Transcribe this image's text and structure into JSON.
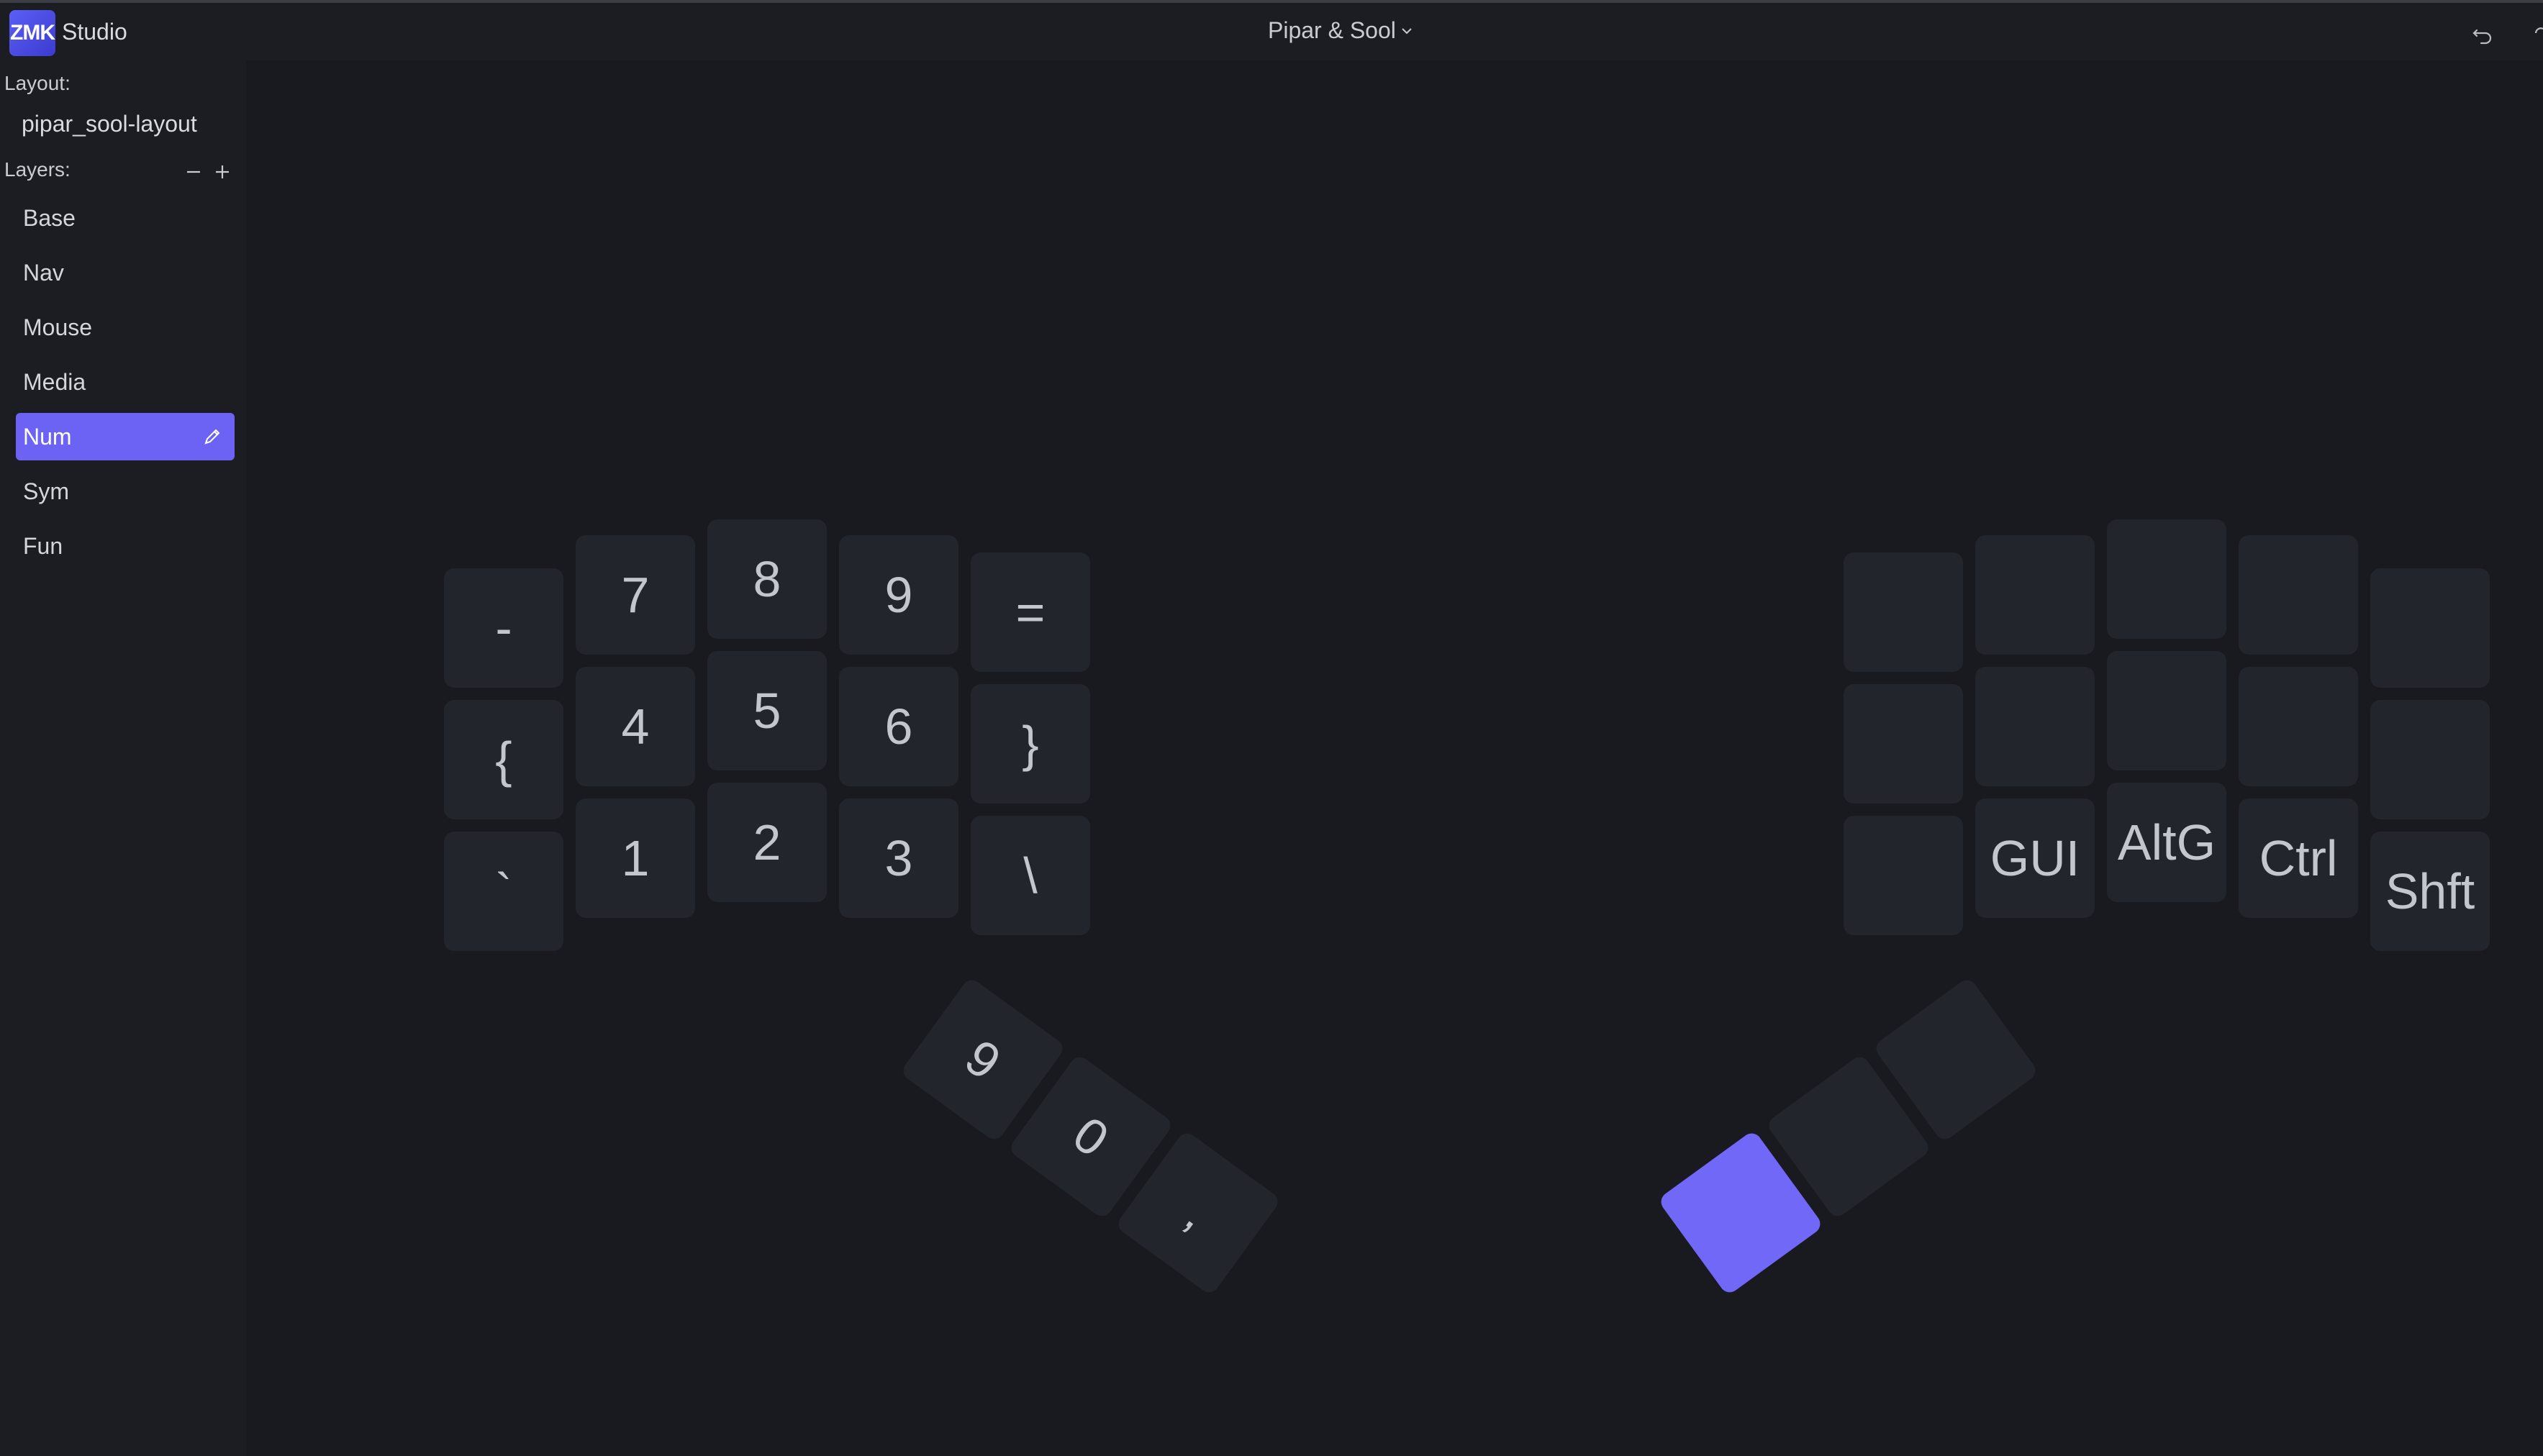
{
  "app": {
    "logo_text": "ZMK",
    "name": "Studio"
  },
  "device": {
    "name": "Pipar & Sool"
  },
  "sidebar": {
    "layout_label": "Layout:",
    "layout_name": "pipar_sool-layout",
    "layers_label": "Layers:",
    "layers": [
      {
        "label": "Base"
      },
      {
        "label": "Nav"
      },
      {
        "label": "Mouse"
      },
      {
        "label": "Media"
      },
      {
        "label": "Num",
        "active": true
      },
      {
        "label": "Sym"
      },
      {
        "label": "Fun"
      }
    ]
  },
  "keyboard": {
    "left": {
      "row1": [
        "-",
        "7",
        "8",
        "9",
        "="
      ],
      "row2": [
        "{",
        "4",
        "5",
        "6",
        "}"
      ],
      "row3": [
        "`",
        "1",
        "2",
        "3",
        "\\"
      ],
      "thumbs": [
        "9",
        "0",
        ","
      ]
    },
    "right": {
      "row1": [
        "",
        "",
        "",
        "",
        ""
      ],
      "row2": [
        "",
        "",
        "",
        "",
        ""
      ],
      "row3": [
        "",
        "GUI",
        "AltG",
        "Ctrl",
        "Shft"
      ],
      "thumbs": [
        "",
        "",
        ""
      ]
    }
  },
  "colors": {
    "accent": "#6c63f5",
    "background": "#181a1f",
    "key": "#22252b"
  }
}
